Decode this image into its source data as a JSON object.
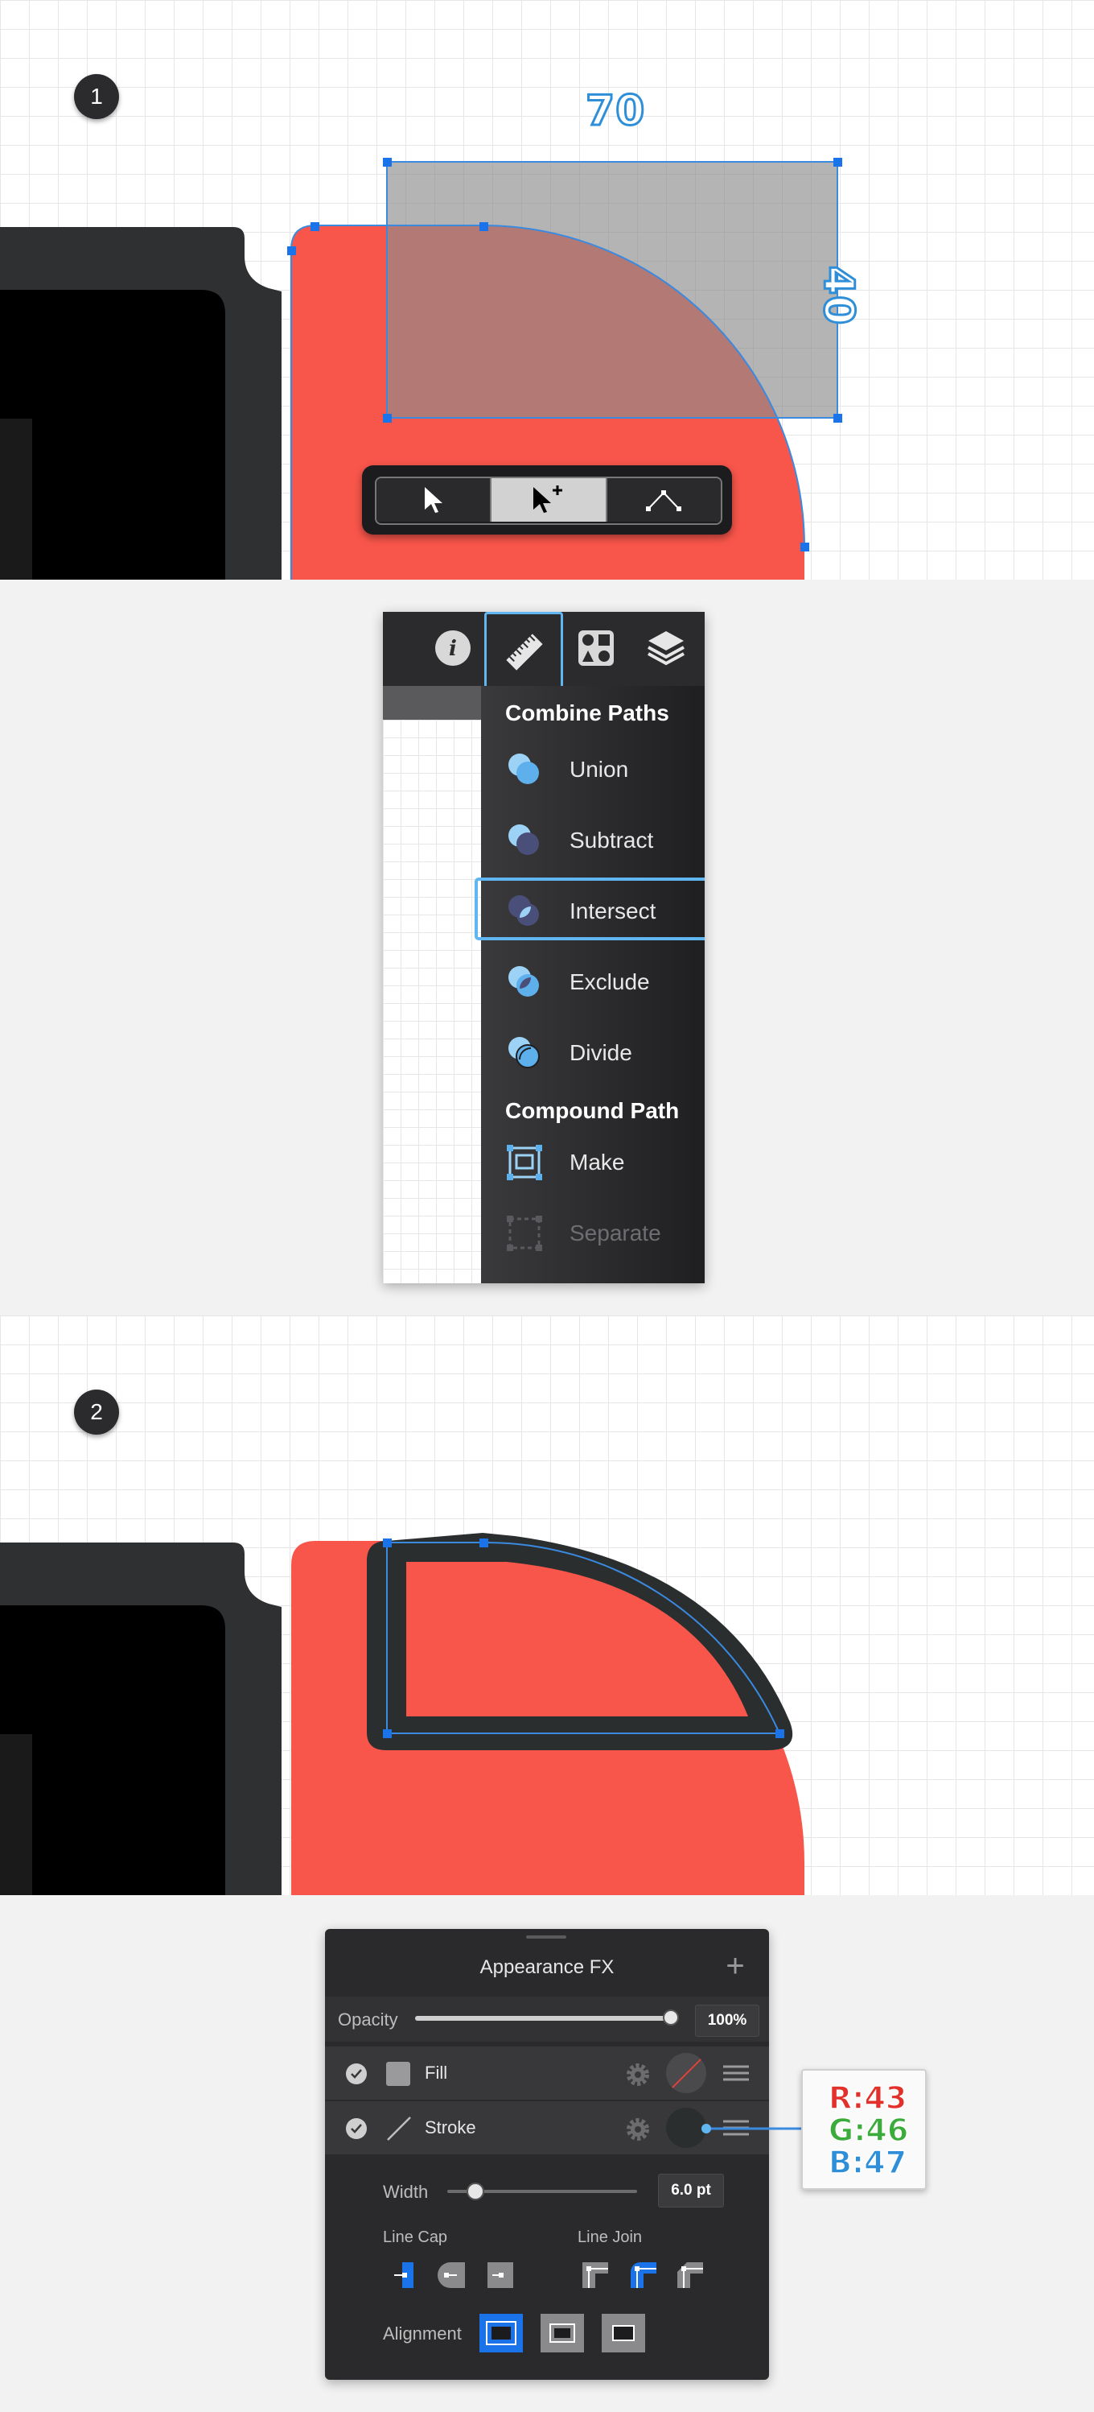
{
  "step1": {
    "badge": "1",
    "width_label": "70",
    "height_label": "40",
    "toolbar": {
      "items": [
        "selection-tool",
        "direct-selection-tool",
        "node-tool"
      ],
      "active_index": 1
    }
  },
  "menu": {
    "tabs": [
      "info-icon",
      "ruler-icon",
      "shapes-icon",
      "layers-icon"
    ],
    "active_tab": "ruler-icon",
    "combine_title": "Combine Paths",
    "combine_items": [
      "Union",
      "Subtract",
      "Intersect",
      "Exclude",
      "Divide"
    ],
    "selected_item": "Intersect",
    "compound_title": "Compound Path",
    "compound_items": [
      "Make",
      "Separate"
    ],
    "disabled_item": "Separate"
  },
  "step2": {
    "badge": "2"
  },
  "appearance": {
    "title": "Appearance FX",
    "add_label": "+",
    "opacity_label": "Opacity",
    "opacity_value": "100%",
    "opacity_level": 1.0,
    "fill_label": "Fill",
    "stroke_label": "Stroke",
    "width_label": "Width",
    "width_value": "6.0 pt",
    "width_level": 0.15,
    "line_cap_label": "Line Cap",
    "line_join_label": "Line Join",
    "alignment_label": "Alignment",
    "selected_cap": "butt-cap",
    "selected_join": "round-join",
    "selected_alignment": "inside"
  },
  "color_callout": {
    "r": "R:43",
    "g": "G:46",
    "b": "B:47"
  },
  "colors": {
    "accent": "#1a73e8",
    "red_shape": "#f9564b",
    "dark_device": "#2b2e2f",
    "panel_bg": "#2a2a2c",
    "stroke_color": "#2b2e2f"
  }
}
